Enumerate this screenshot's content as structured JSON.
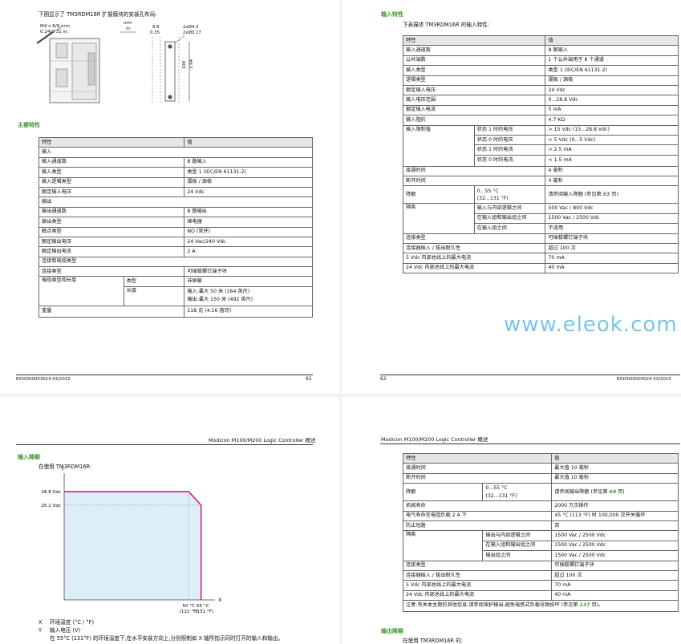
{
  "p61": {
    "intro": "下图显示了 TM3RDM16R 扩展模块的安装孔布局:",
    "fig": {
      "screw": "M4 x 6/8 mm",
      "screw_in": "0.24/0.31 in.",
      "unit_mm": "mm",
      "unit_in": "in.",
      "dim_w_mm": "8.8",
      "dim_w_in": "0.35",
      "hole_mm": "2xØ4.3",
      "hole_in": "2xØ0.17",
      "dim_h_mm": "100",
      "dim_h_in": "3.94"
    },
    "heading": "主要特性",
    "table_header": [
      "特性",
      "值"
    ],
    "sec_input": "输入",
    "rows_input": [
      [
        "输入通道数",
        "8 路输入"
      ],
      [
        "输入类型",
        "类型 1 (IEC/EN 61131-2)"
      ],
      [
        "输入逻辑类型",
        "漏极 / 源极"
      ],
      [
        "额定输入电压",
        "24 Vdc"
      ]
    ],
    "sec_output": "输出",
    "rows_output": [
      [
        "输出通道数",
        "8 路输出"
      ],
      [
        "输出类型",
        "继电器"
      ],
      [
        "触点类型",
        "NO (常开)"
      ],
      [
        "额定输出电压",
        "24 Vac/240 Vdc"
      ],
      [
        "额定输出电流",
        "2 A"
      ]
    ],
    "sec_conn": "连接和电缆类型",
    "conn_type": [
      "连接类型",
      "可插拔螺钉端子块"
    ],
    "cable": {
      "label": "电缆类型和长度",
      "type_k": "类型",
      "type_v": "非屏蔽",
      "len_k": "长度",
      "len_v1": "输入:最大 50 米 (164 英尺)",
      "len_v2": "输出:最大 150 米 (492 英尺)"
    },
    "weight": [
      "重量",
      "118 克 (4.16 盎司)"
    ],
    "footer_left": "EIO0000003024 03/2015",
    "footer_right": "61"
  },
  "p62": {
    "heading": "输入特性",
    "intro": "下表描述 TM3RDM16R 的输入特性:",
    "table_header": [
      "特性",
      "值"
    ],
    "rows_a": [
      [
        "输入通道数",
        "8 路输入"
      ],
      [
        "公共端数",
        "1 个公共端用于 8 个通道"
      ],
      [
        "输入类型",
        "类型 1 (IEC/EN 61131-2)"
      ],
      [
        "逻辑类型",
        "漏极 / 源极"
      ],
      [
        "额定输入电压",
        "24 Vdc"
      ],
      [
        "输入电压范围",
        "0...28.8 Vdc"
      ],
      [
        "额定输入电流",
        "5 mA"
      ],
      [
        "输入阻抗",
        "4.7 KΩ"
      ]
    ],
    "limit_label": "输入限制值",
    "limit_rows": [
      [
        "状态 1 时的电压",
        "> 15 Vdc (15...28.8 Vdc)"
      ],
      [
        "状态 0 时的电压",
        "< 5 Vdc (0...5 Vdc)"
      ],
      [
        "状态 1 时的电流",
        "> 2.5 mA"
      ],
      [
        "状态 0 时的电流",
        "< 1.5 mA"
      ]
    ],
    "rows_b": [
      [
        "接通时间",
        "4 毫秒"
      ],
      [
        "断开时间",
        "4 毫秒"
      ]
    ],
    "derate": {
      "label": "降额",
      "range1": "0...55 °C",
      "range2": "(32...131 °F)",
      "val_pre": "请参阅输入降额 (参见第 ",
      "val_ref": "63",
      "val_post": " 页)"
    },
    "iso_label": "隔离",
    "iso_rows": [
      [
        "输入与内部逻辑之间",
        "500 Vac / 800 Vdc"
      ],
      [
        "在输入组和输出组之间",
        "1500 Vac / 2500 Vdc"
      ],
      [
        "在输入组之间",
        "不适用"
      ]
    ],
    "rows_c": [
      [
        "连接类型",
        "可插拔螺钉端子块"
      ],
      [
        "连接器插入 / 拔出耐久性",
        "超过 100 次"
      ],
      [
        "5 Vdc 内部总线上的最大电流",
        "70 mA"
      ],
      [
        "24 Vdc 内部总线上的最大电流",
        "40 mA"
      ]
    ],
    "watermark": "www.eleok.com",
    "footer_left": "62",
    "footer_right": "EIO0000003024 03/2015"
  },
  "p63": {
    "header": "Modicon M100/M200 Logic Controller 概述",
    "heading": "输入降额",
    "using": "在使用 TM3RDM16R:",
    "axis_y": "Y",
    "axis_x": "X",
    "y_hi": "28.8 Vdc",
    "y_lo": "25.2 Vdc",
    "x_1a": "50 °C",
    "x_1b": "(122 °F)",
    "x_2a": "55 °C",
    "x_2b": "(131 °F)",
    "legend_x_k": "X",
    "legend_x_v": "环境温度 (°C / °F)",
    "legend_y_k": "Y",
    "legend_y_v": "输入电压 (V)",
    "note": "在 55°C (131°F) 的环境温度下,在水平安装方向上,分别限制如 X 轴所指示同时打开的输入和输出。",
    "chart_data": {
      "type": "line",
      "x": [
        0,
        50,
        55,
        55
      ],
      "y": [
        28.8,
        28.8,
        25.2,
        0
      ],
      "xlabel": "X",
      "ylabel": "Y",
      "x_ticks": [
        "50 °C (122 °F)",
        "55 °C (131 °F)"
      ],
      "y_ticks": [
        "28.8 Vdc",
        "25.2 Vdc"
      ],
      "xlim": [
        0,
        58
      ],
      "ylim": [
        0,
        32
      ]
    }
  },
  "p64": {
    "header": "Modicon M100/M200 Logic Controller 概述",
    "table_header": [
      "特性",
      "值"
    ],
    "rows_a": [
      [
        "接通时间",
        "最大值 10 毫秒"
      ],
      [
        "断开时间",
        "最大值 10 毫秒"
      ]
    ],
    "derate": {
      "label": "降额",
      "range1": "0...55 °C",
      "range2": "(32...131 °F)",
      "val_pre": "请参阅输出降额 (参见第 ",
      "val_ref": "64",
      "val_post": " 页)"
    },
    "rows_b": [
      [
        "机械寿命",
        "2000 万次操作"
      ],
      [
        "电气寿命在电阻负载 2 A 下",
        "45 °C (113 °F) 时 100,000 次开关循环"
      ],
      [
        "防止短路",
        "否"
      ]
    ],
    "iso_label": "隔离",
    "iso_rows": [
      [
        "输出与内部逻辑之间",
        "1500 Vac / 2500 Vdc"
      ],
      [
        "在输入组和输出组之间",
        "1500 Vac / 2500 Vdc"
      ],
      [
        "输出组之间",
        "1500 Vac / 2500 Vdc"
      ]
    ],
    "rows_c": [
      [
        "连接类型",
        "可插拔螺钉端子块"
      ],
      [
        "连接器插入 / 拔出耐久性",
        "超过 100 次"
      ],
      [
        "5 Vdc 内部总线上的最大电流",
        "70 mA"
      ],
      [
        "24 Vdc 内部总线上的最大电流",
        "40 mA"
      ]
    ],
    "note_pre": "注意:有关本主题的其他信息,请参阅保护输出,避免电感式负载导致损坏 (参见第 ",
    "note_ref": "137",
    "note_post": " 页)。",
    "heading": "输出降额",
    "using": "在使用 TM3RDM16R 时:"
  }
}
